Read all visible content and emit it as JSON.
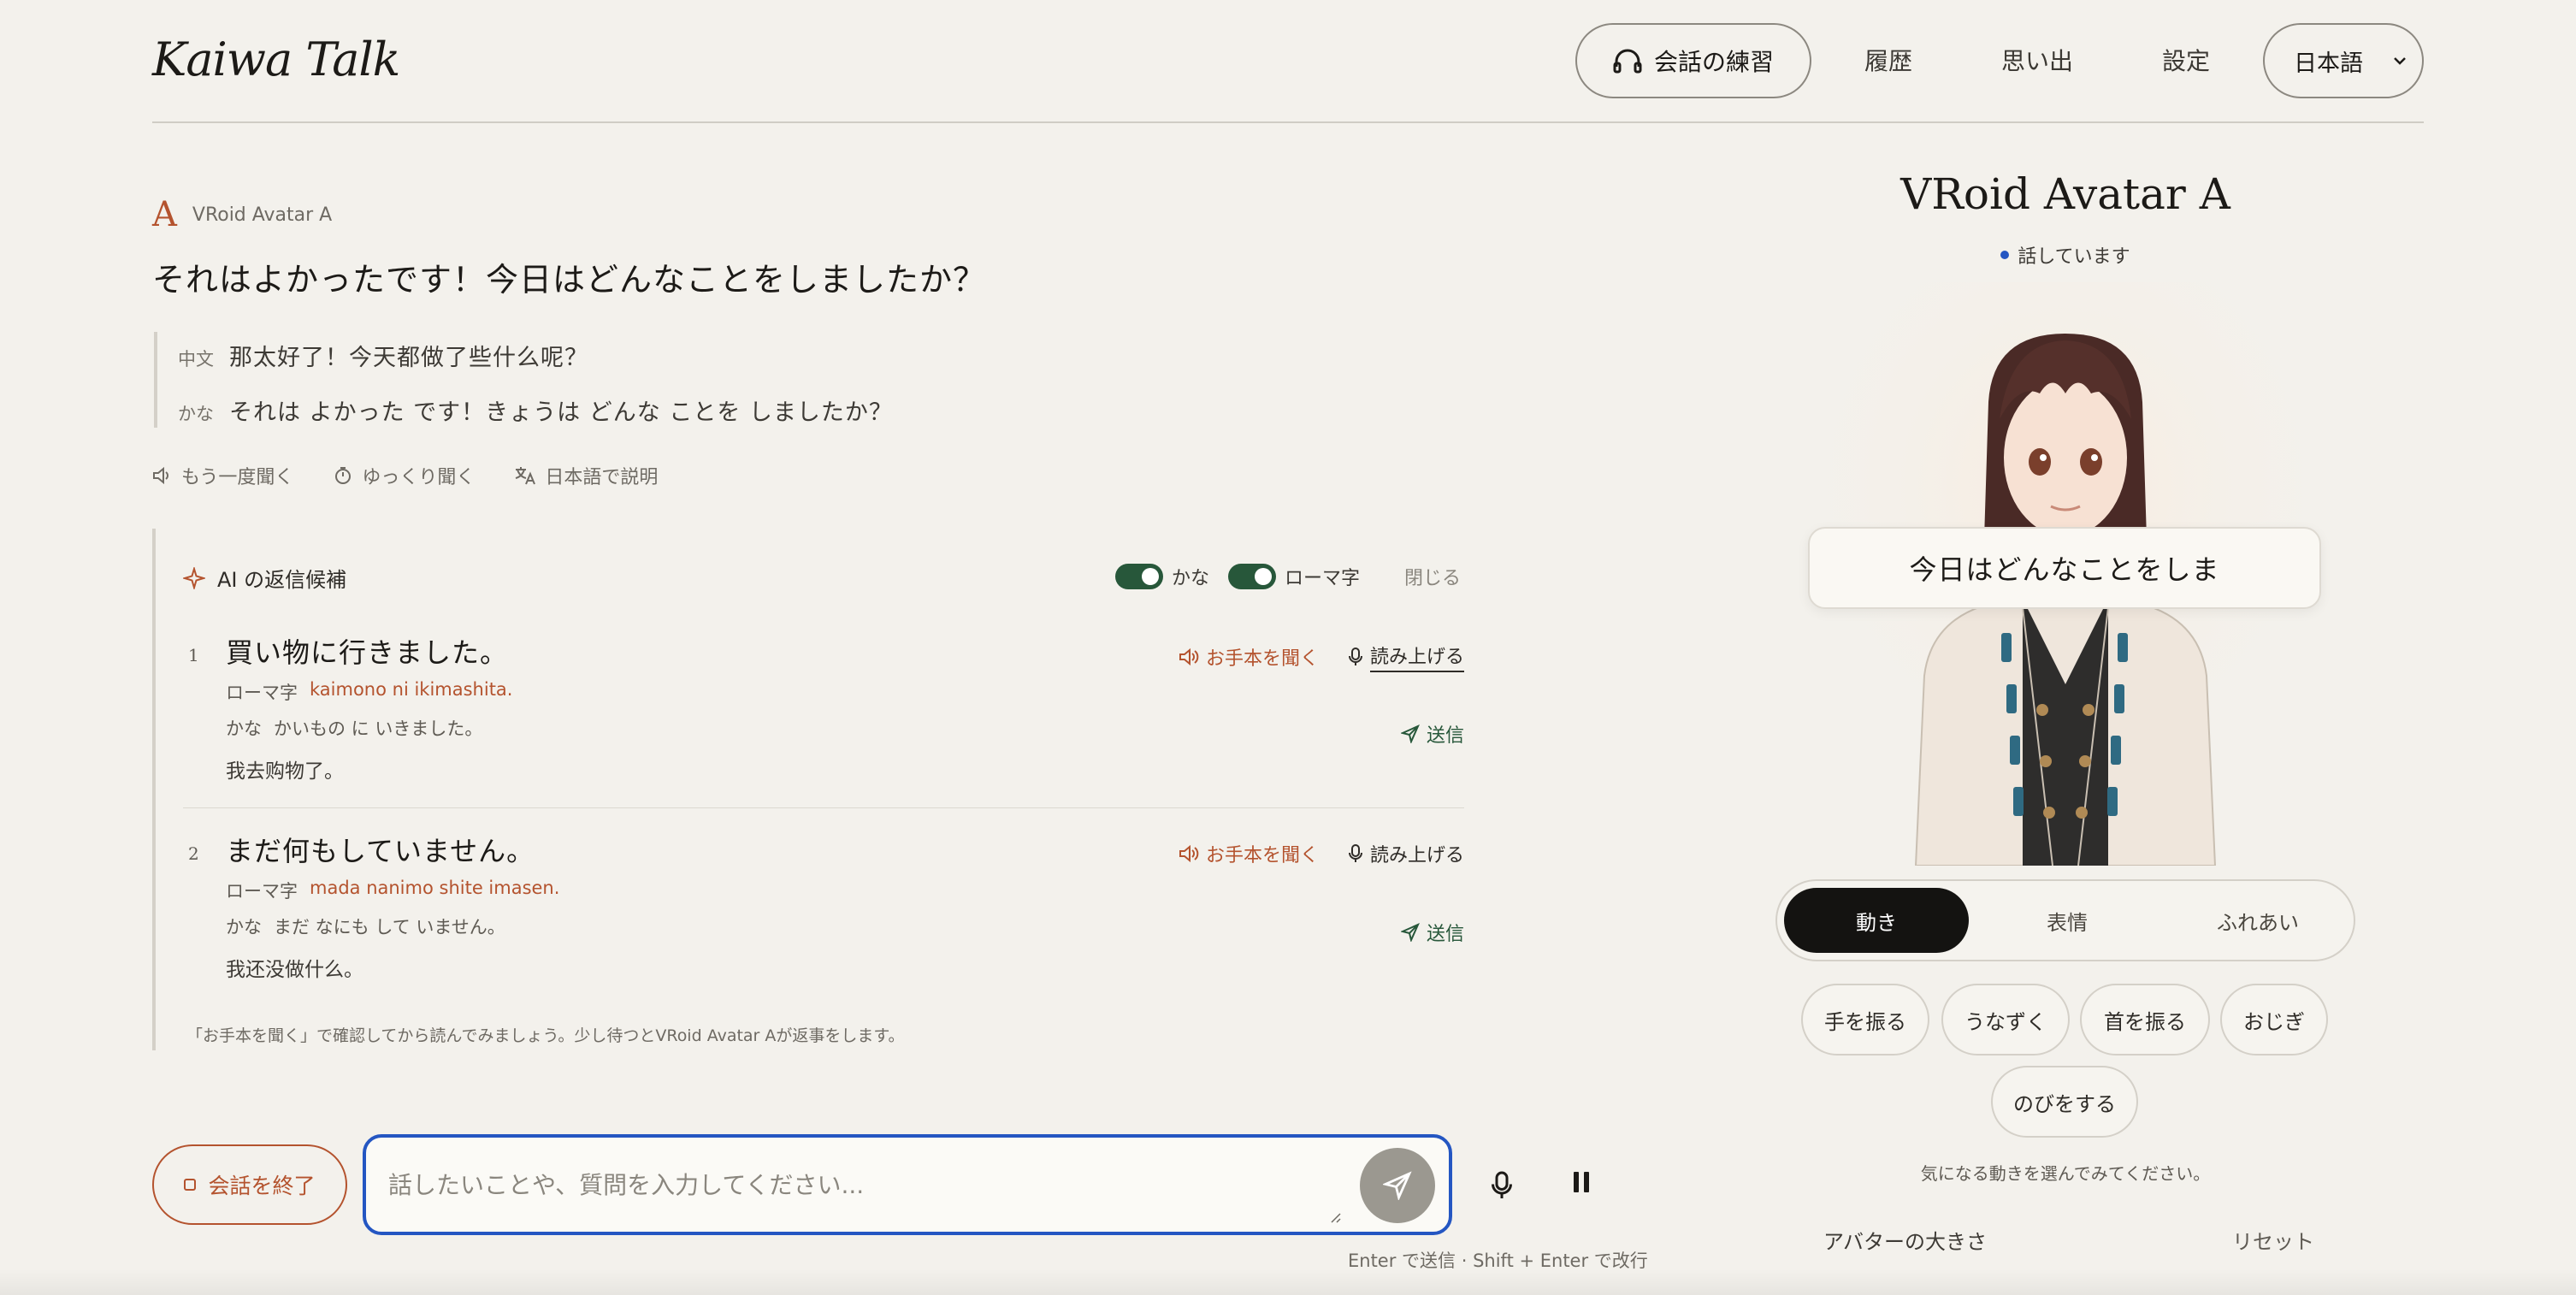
{
  "app": {
    "title": "Kaiwa Talk"
  },
  "nav": {
    "practice": "会話の練習",
    "history": "履歴",
    "memories": "思い出",
    "settings": "設定",
    "language": "日本語"
  },
  "message": {
    "speaker_mark": "A",
    "speaker_name": "VRoid Avatar A",
    "text": "それはよかったです！今日はどんなことをしましたか？",
    "translations": [
      {
        "label": "中文",
        "text": "那太好了！今天都做了些什么呢？"
      },
      {
        "label": "かな",
        "text": "それは よかった です！きょうは どんな ことを しましたか？"
      }
    ],
    "actions": {
      "replay": "もう一度聞く",
      "slow": "ゆっくり聞く",
      "explain": "日本語で説明"
    }
  },
  "suggestions": {
    "title": "AI の返信候補",
    "toggle_kana": "かな",
    "toggle_romaji": "ローマ字",
    "close": "閉じる",
    "listen_label": "お手本を聞く",
    "read_label": "読み上げる",
    "send_label": "送信",
    "romaji_label": "ローマ字",
    "kana_label": "かな",
    "items": [
      {
        "num": "1",
        "jp": "買い物に行きました。",
        "romaji": "kaimono ni ikimashita.",
        "kana": "かいもの に いきました。",
        "zh": "我去购物了。"
      },
      {
        "num": "2",
        "jp": "まだ何もしていません。",
        "romaji": "mada nanimo shite imasen.",
        "kana": "まだ なにも して いません。",
        "zh": "我还没做什么。"
      }
    ],
    "hint": "「お手本を聞く」で確認してから読んでみましょう。少し待つとVRoid Avatar Aが返事をします。"
  },
  "composer": {
    "end_label": "会話を終了",
    "placeholder": "話したいことや、質問を入力してください...",
    "kbd_hint": "Enter で送信 · Shift + Enter で改行"
  },
  "avatar": {
    "name": "VRoid Avatar A",
    "status": "話しています",
    "bubble": "今日はどんなことをしま",
    "tabs": [
      "動き",
      "表情",
      "ふれあい"
    ],
    "active_tab": "動き",
    "motions": [
      "手を振る",
      "うなずく",
      "首を振る",
      "おじぎ",
      "のびをする"
    ],
    "motions_hint": "気になる動きを選んでみてください。",
    "size_label": "アバターの大きさ",
    "reset": "リセット"
  },
  "colors": {
    "accent": "#b4532e",
    "toggle_on": "#27573a",
    "focus": "#2456c2",
    "background": "#f3f1ec"
  }
}
